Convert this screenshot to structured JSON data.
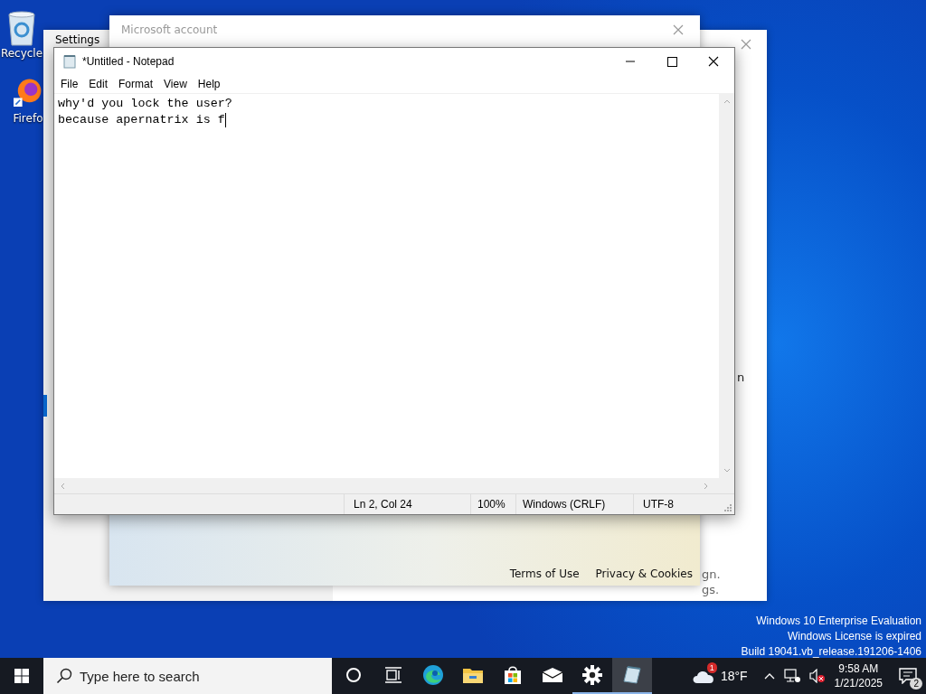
{
  "desktop_icons": [
    {
      "label": "Recycle",
      "kind": "recycle"
    },
    {
      "label": "Firefo",
      "kind": "firefox"
    }
  ],
  "settings_window": {
    "title": "Settings",
    "fragments": [
      "n",
      "gn.",
      "gs."
    ]
  },
  "account_window": {
    "title": "Microsoft account",
    "links": [
      "Terms of Use",
      "Privacy & Cookies"
    ]
  },
  "notepad": {
    "title": "*Untitled - Notepad",
    "menu": [
      "File",
      "Edit",
      "Format",
      "View",
      "Help"
    ],
    "lines": [
      "why'd you lock the user?",
      "because apernatrix is f"
    ],
    "status": [
      "Ln 2, Col 24",
      "100%",
      "Windows (CRLF)",
      "UTF-8"
    ]
  },
  "license_notice": [
    "Windows 10 Enterprise Evaluation",
    "Windows License is expired",
    "Build 19041.vb_release.191206-1406"
  ],
  "taskbar": {
    "search": {
      "placeholder": "Type here to search"
    },
    "apps": [
      {
        "kind": "cortana",
        "running": false,
        "active": false
      },
      {
        "kind": "taskview",
        "running": false,
        "active": false
      },
      {
        "kind": "edge",
        "running": false,
        "active": false
      },
      {
        "kind": "explorer",
        "running": false,
        "active": false
      },
      {
        "kind": "store",
        "running": false,
        "active": false
      },
      {
        "kind": "mail",
        "running": false,
        "active": false
      },
      {
        "kind": "settings",
        "running": true,
        "active": false
      },
      {
        "kind": "notepad",
        "running": true,
        "active": true
      }
    ],
    "weather": {
      "temperature": "18°F",
      "badge": "1"
    },
    "clock": {
      "time": "9:58 AM",
      "date": "1/21/2025"
    },
    "notifications": {
      "count": "2"
    }
  }
}
